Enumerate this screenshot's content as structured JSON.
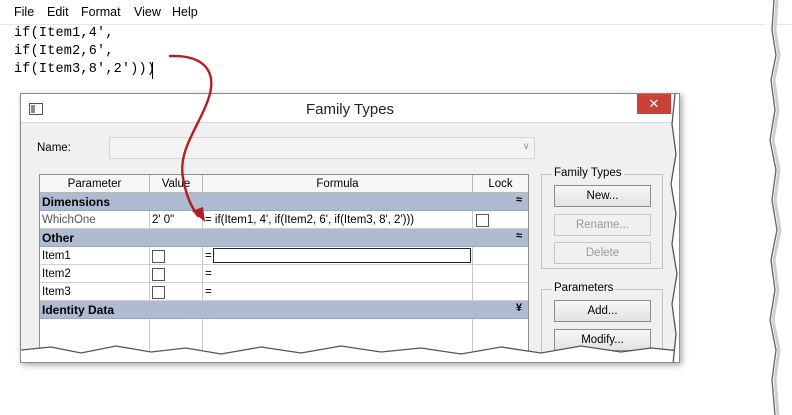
{
  "notepad": {
    "menu": [
      "File",
      "Edit",
      "Format",
      "View",
      "Help"
    ],
    "lines": [
      "if(Item1,4',",
      "if(Item2,6',",
      "if(Item3,8',2')))"
    ]
  },
  "dialog": {
    "title": "Family Types",
    "close_glyph": "✕",
    "name_label": "Name:",
    "name_value": "",
    "grid": {
      "headers": [
        "Parameter",
        "Value",
        "Formula",
        "Lock"
      ],
      "groups": [
        {
          "label": "Dimensions",
          "chevron": "≈",
          "rows": [
            {
              "parameter": "WhichOne",
              "value": "2'  0\"",
              "formula": "= if(Item1, 4', if(Item2, 6', if(Item3, 8', 2')))",
              "has_value_checkbox": false,
              "has_lock_checkbox": true
            }
          ]
        },
        {
          "label": "Other",
          "chevron": "≈",
          "rows": [
            {
              "parameter": "Item1",
              "value": "",
              "formula": "=",
              "has_value_checkbox": true,
              "has_lock_checkbox": false
            },
            {
              "parameter": "Item2",
              "value": "",
              "formula": "=",
              "has_value_checkbox": true,
              "has_lock_checkbox": false
            },
            {
              "parameter": "Item3",
              "value": "",
              "formula": "=",
              "has_value_checkbox": true,
              "has_lock_checkbox": false
            }
          ]
        },
        {
          "label": "Identity Data",
          "chevron": "¥",
          "rows": []
        }
      ]
    },
    "family_types": {
      "title": "Family Types",
      "new_label": "New...",
      "rename_label": "Rename...",
      "delete_label": "Delete"
    },
    "parameters": {
      "title": "Parameters",
      "add_label": "Add...",
      "modify_label": "Modify..."
    }
  },
  "colors": {
    "group_header": "#aebbd0",
    "close_button": "#c7433a",
    "arrow": "#b21e22"
  }
}
